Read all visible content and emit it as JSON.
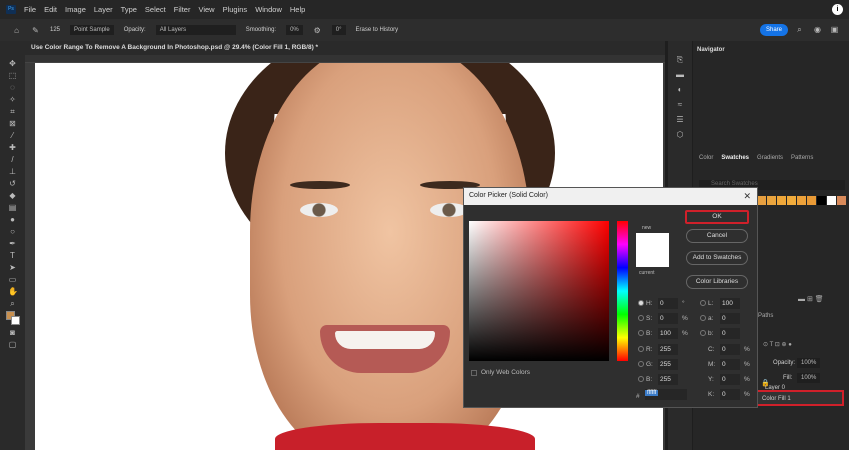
{
  "menu": {
    "logo": "Ps",
    "items": [
      "File",
      "Edit",
      "Image",
      "Layer",
      "Type",
      "Select",
      "Filter",
      "View",
      "Plugins",
      "Window",
      "Help"
    ]
  },
  "options": {
    "brush_size": "125",
    "mode": "Point Sample",
    "opacity_label": "Opacity:",
    "layers": "All Layers",
    "smoothing_label": "Smoothing:",
    "smoothing": "0%",
    "angle": "0°",
    "erase_history": "Erase to History",
    "share": "Share"
  },
  "document": {
    "tab_title": "Use Color Range To Remove A Background In Photoshop.psd @ 29.4% (Color Fill 1, RGB/8) *"
  },
  "panels": {
    "navigator": "Navigator",
    "tabs": [
      "Color",
      "Swatches",
      "Gradients",
      "Patterns"
    ],
    "search_placeholder": "Search Swatches",
    "layers_tab": "Paths",
    "opacity_label": "Opacity:",
    "opacity": "100%",
    "fill_label": "Fill:",
    "fill": "100%",
    "layers": [
      "Layer 0",
      "Color Fill 1"
    ],
    "swatches": [
      "#e8a040",
      "#eba53e",
      "#f0a83a",
      "#f2ac3c",
      "#eea23a",
      "#e99a36",
      "#000000",
      "#ffffff",
      "#d98a5a"
    ]
  },
  "dialog": {
    "title": "Color Picker (Solid Color)",
    "new_label": "new",
    "current_label": "current",
    "ok": "OK",
    "cancel": "Cancel",
    "add_swatches": "Add to Swatches",
    "libraries": "Color Libraries",
    "only_web": "Only Web Colors",
    "hsb": [
      {
        "l": "H:",
        "v": "0",
        "u": "°"
      },
      {
        "l": "S:",
        "v": "0",
        "u": "%"
      },
      {
        "l": "B:",
        "v": "100",
        "u": "%"
      }
    ],
    "rgb": [
      {
        "l": "R:",
        "v": "255"
      },
      {
        "l": "G:",
        "v": "255"
      },
      {
        "l": "B:",
        "v": "255"
      }
    ],
    "lab": [
      {
        "l": "L:",
        "v": "100"
      },
      {
        "l": "a:",
        "v": "0"
      },
      {
        "l": "b:",
        "v": "0"
      }
    ],
    "cmyk": [
      {
        "l": "C:",
        "v": "0",
        "u": "%"
      },
      {
        "l": "M:",
        "v": "0",
        "u": "%"
      },
      {
        "l": "Y:",
        "v": "0",
        "u": "%"
      },
      {
        "l": "K:",
        "v": "0",
        "u": "%"
      }
    ],
    "hex_label": "#",
    "hex": "ffffff"
  }
}
